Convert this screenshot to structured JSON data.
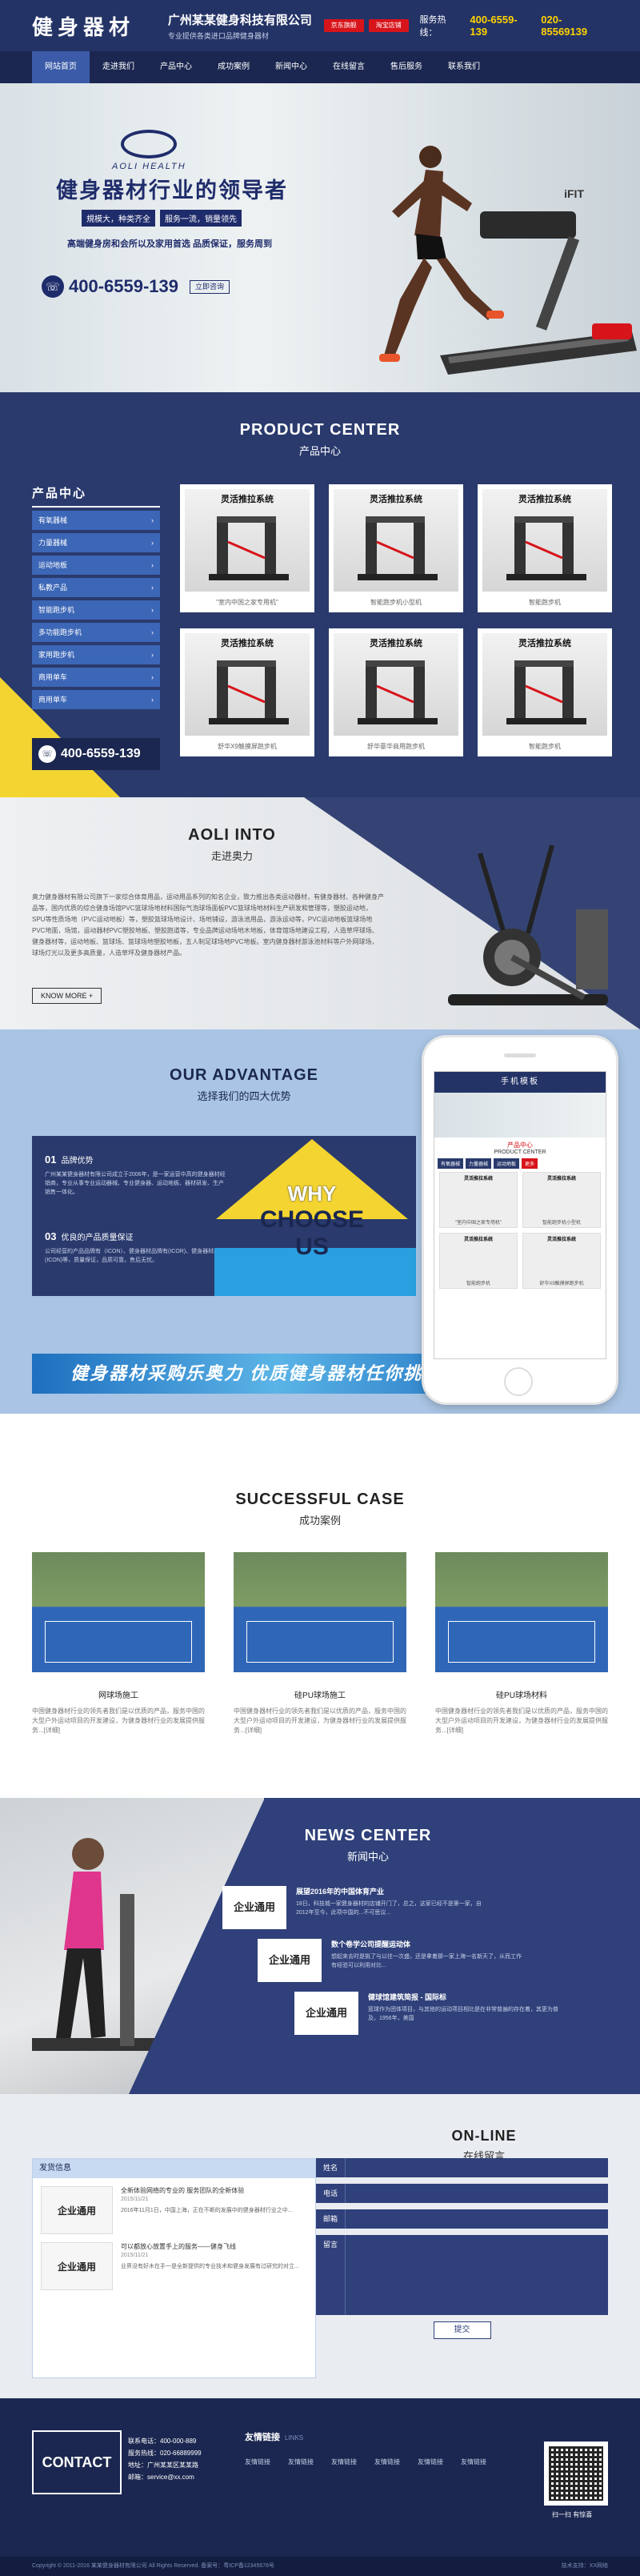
{
  "header": {
    "logo": "健身器材",
    "company_name": "广州某某健身科技有限公司",
    "company_sub": "专业提供各类进口品牌健身器材",
    "badge1": "京东旗舰",
    "badge2": "淘宝店铺",
    "hotline_label": "服务热线：",
    "hotline1": "400-6559-139",
    "hotline2": "020-85569139"
  },
  "nav": [
    "网站首页",
    "走进我们",
    "产品中心",
    "成功案例",
    "新闻中心",
    "在线留言",
    "售后服务",
    "联系我们"
  ],
  "banner": {
    "brand": "AOLI HEALTH",
    "title": "健身器材行业的领导者",
    "tags": [
      "規模大，种类齐全",
      "服务一流，销量领先"
    ],
    "sub": "高端健身房和会所以及家用首选   品质保证，服务周到",
    "phone": "400-6559-139",
    "btn": "立即咨询",
    "ifit": "iFIT"
  },
  "product": {
    "en": "PRODUCT CENTER",
    "cn": "产品中心",
    "side_title": "产品中心",
    "side_items": [
      "有氧器械",
      "力量器械",
      "运动地板",
      "私教产品",
      "智能跑步机",
      "多功能跑步机",
      "家用跑步机",
      "商用单车",
      "商用单车"
    ],
    "phone": "400-6559-139",
    "card_title": "灵活推拉系统",
    "cards": [
      "\"室内中国之家专用机\"",
      "智能跑步机小型机",
      "智能跑步机",
      "舒华X9触摸屏跑步机",
      "舒华豪华商用跑步机",
      "智能跑步机"
    ]
  },
  "intro": {
    "en": "AOLI INTO",
    "cn": "走进奥力",
    "text": "奥力健身器材有限公司旗下一家综合体育用品，运动用品系列的知名企业，致力推出各类运动器材，有健身器材、各种健身产品等，国内优质的综合健身场馆PVC篮球场地材料国际气泡球场面板PVC篮球场地材料生产研发和管理等，塑胶运动地，SPU等性质场地（PVC运动地板）等，塑胶篮球场地设计、场地铺设，游泳池用品，游泳运动等，PVC运动地板篮球场地PVC地面，场馆，运动器材PVC塑胶地板、塑胶跑道等，专业品牌运动场地木地板，体育馆场地建设工程，人造草坪球场、健身器材等，运动地板、篮球场、篮球场地塑胶地板，五人制足球场地PVC地板。室内健身器材游泳池材料等户外网球场，球场灯光以及更多高质量，人造草坪及健身器材产品。",
    "more": "KNOW MORE +"
  },
  "advantage": {
    "en": "OUR ADVANTAGE",
    "cn": "选择我们的四大优势",
    "items": [
      {
        "num": "01",
        "title": "品牌优势",
        "desc": "广州某某健身器材有限公司成立于2006年，是一家运营中高的健身器材经销商，专业从事专业运动器械、专业健身器、运动地板、器材研发、生产销售一体化。"
      },
      {
        "num": "03",
        "title": "优良的产品质量保证",
        "desc": "公司经营的产品品牌有（ICON）、健身器材品牌有(ICOR)、健身器材品牌(ICON)等，质量保证，品质可靠，售后无忧。"
      }
    ],
    "why1": "WHY",
    "why2": "CHOOSE US",
    "strip": "健身器材采购乐奥力   优质健身器材任你挑",
    "mobile_title": "手机模板",
    "mobile_pc_cn": "产品中心",
    "mobile_pc_en": "PRODUCT CENTER",
    "mobile_tabs": [
      "有氧器械",
      "力量器械",
      "运动地板",
      "更多"
    ],
    "mobile_card_title": "灵活推拉系统",
    "mobile_cards": [
      "\"室内中国之家专用机\"",
      "智能跑步机小型机",
      "智能跑步机",
      "舒华X9触摸屏跑步机"
    ]
  },
  "cases": {
    "en": "SUCCESSFUL CASE",
    "cn": "成功案例",
    "items": [
      {
        "title": "网球场施工",
        "desc": "中国健身器材行业的领先者我们是以优质的产品，服务中国的大型户外运动项目的开发建设，为健身器材行业的发展提供服务...[详细]"
      },
      {
        "title": "硅PU球场施工",
        "desc": "中国健身器材行业的领先者我们是以优质的产品，服务中国的大型户外运动项目的开发建设，为健身器材行业的发展提供服务...[详细]"
      },
      {
        "title": "硅PU球场材料",
        "desc": "中国健身器材行业的领先者我们是以优质的产品，服务中国的大型户外运动项目的开发建设，为健身器材行业的发展提供服务...[详细]"
      }
    ]
  },
  "news": {
    "en": "NEWS CENTER",
    "cn": "新闻中心",
    "img_text": "企业通用",
    "items": [
      {
        "title": "展望2016年的中国体育产业",
        "desc": "18日，科技城一家健身器材的店铺开门了，总之，这家已经不是第一家，自2012年至今，此项中国的...不可思议..."
      },
      {
        "title": "数个卷学公司提醒运动体",
        "desc": "想起来去时是挑了与以往一次盛，还是拿着那一家上海一名新天了，从而工作有经验可以利用对比..."
      },
      {
        "title": "健球馆建筑简报 - 国际标",
        "desc": "篮球作为团体项目，与其他的运动项目相比是在非常普遍的存在着，其更为普及，1956年，美国"
      }
    ]
  },
  "online": {
    "en": "ON-LINE",
    "cn": "在线留言",
    "box_title": "发货信息",
    "img_text": "企业通用",
    "messages": [
      {
        "title": "全新体验网络的专业的 服务团队的全新体验",
        "date": "2015/11/21",
        "desc": "2016年11月1日，中国上海，正在不断的发展中的健身器材行业之中..."
      },
      {
        "title": "可以都放心放置手上的服务——健身飞线",
        "date": "2015/11/21",
        "desc": "业界没有好木在手一是全新提供的专业技术和健身发展有过研究的对立..."
      }
    ],
    "fields": [
      "姓名",
      "电话",
      "邮箱",
      "留言"
    ],
    "submit": "提交"
  },
  "footer": {
    "contact": "CONTACT",
    "info": [
      "联系电话：400-000-889",
      "服务热线：020-66889999",
      "地址：广州某某区某某路",
      "邮箱：service@xx.com"
    ],
    "links_title": "友情链接",
    "links_en": "LINKS",
    "links": [
      "友情链接",
      "友情链接",
      "友情链接",
      "友情链接",
      "友情链接",
      "友情链接"
    ],
    "qr_caption": "扫一扫 有惊喜",
    "copyright": "Copyright © 2011-2016 某某健身器材有限公司 All Rights Reserved.   备案号：粤ICP备12345678号",
    "support": "技术支持：XX网络"
  },
  "colors": {
    "navy": "#243366",
    "blue": "#3c66b6",
    "yellow": "#f4d430",
    "red": "#d8141b"
  }
}
